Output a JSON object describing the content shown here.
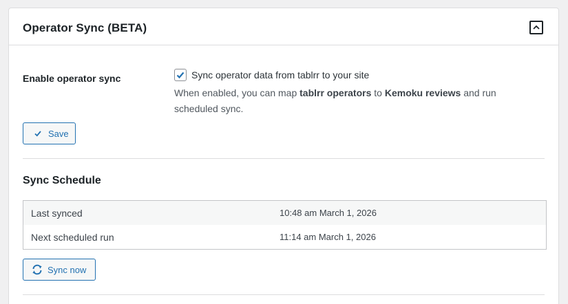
{
  "panel": {
    "title": "Operator Sync (BETA)",
    "collapse_icon": "chevron-up-icon"
  },
  "settings": {
    "field_label": "Enable operator sync",
    "checkbox_checked": true,
    "checkbox_label": "Sync operator data from tablrr to your site",
    "description_prefix": "When enabled, you can map ",
    "description_bold_1": "tablrr operators",
    "description_mid": " to ",
    "description_bold_2": "Kemoku reviews",
    "description_suffix": " and run scheduled sync.",
    "save_label": "Save",
    "save_icon": "checkmark-icon"
  },
  "schedule": {
    "title": "Sync Schedule",
    "rows": [
      {
        "label": "Last synced",
        "value": "10:48 am March 1, 2026"
      },
      {
        "label": "Next scheduled run",
        "value": "11:14 am March 1, 2026"
      }
    ],
    "sync_label": "Sync now",
    "sync_icon": "refresh-icon"
  },
  "colors": {
    "accent": "#2271b1",
    "border": "#dcdcde",
    "text": "#1d2327",
    "muted_text": "#50575e",
    "row_alt_bg": "#f6f7f7"
  }
}
